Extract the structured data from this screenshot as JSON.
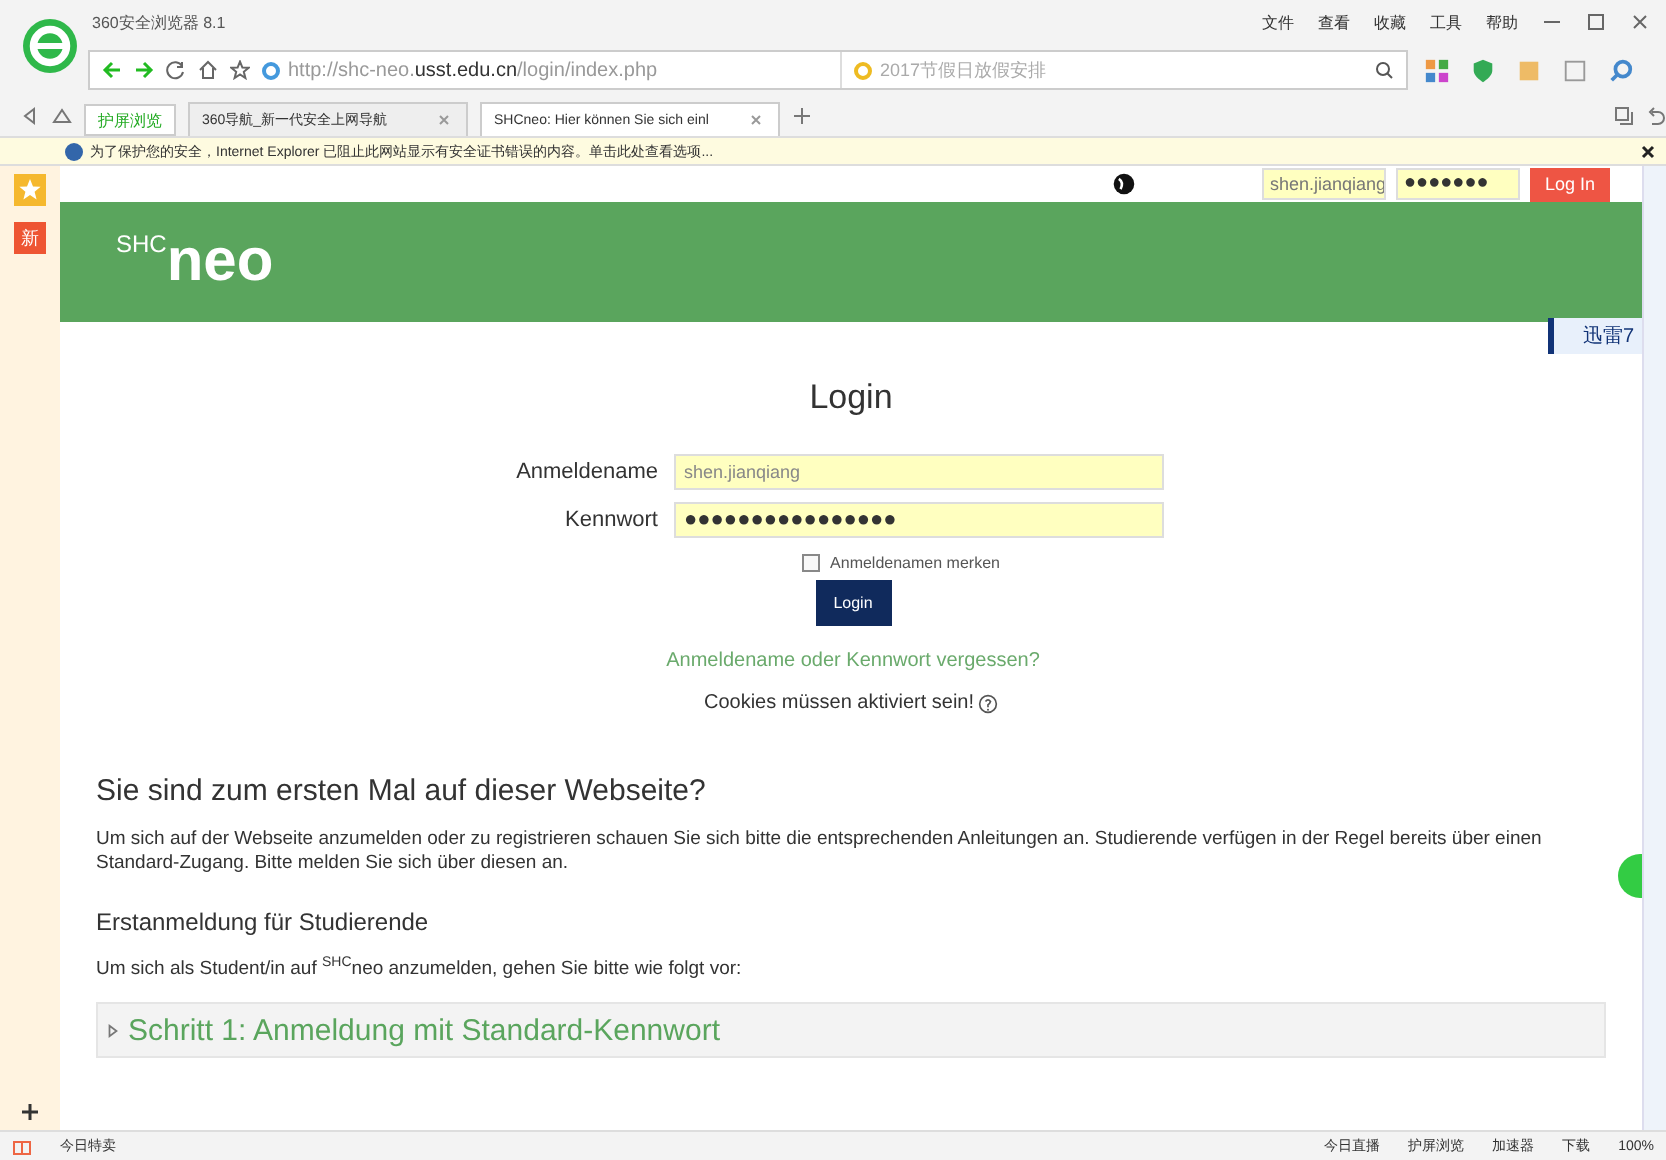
{
  "browser": {
    "title": "360安全浏览器 8.1",
    "menu": [
      "文件",
      "查看",
      "收藏",
      "工具",
      "帮助"
    ],
    "address": "http://shc-neo.**usst.edu.cn**/login/index.php",
    "search": {
      "placeholder": "2017节假日放假安排"
    },
    "screen_mode": "护屏浏览",
    "tabs": [
      {
        "label": "360导航_新一代安全上网导航",
        "selected": false
      },
      {
        "label": "SHCneo: Hier können Sie sich einl",
        "selected": true
      }
    ],
    "info_bar": "为了保护您的安全，Internet Explorer 已阻止此网站显示有安全证书错误的内容。单击此处查看选项...",
    "side_badge": "新",
    "download_badge": "迅雷7"
  },
  "page": {
    "top_login": {
      "username": "shen.jianqiang",
      "password": "●●●●●●●",
      "button": "Log In"
    },
    "logo": "$^{SHC}$neo",
    "login": {
      "title": "Login",
      "fields": [
        {
          "label": "Anmeldename",
          "value": "shen.jianqiang",
          "kind": "text"
        },
        {
          "label": "Kennwort",
          "value": "●●●●●●●●●●●●●●●●",
          "kind": "password"
        }
      ],
      "remember": {
        "label": "Anmeldenamen merken",
        "checked": false
      },
      "button": "Login",
      "forgot_link": "Anmeldename oder Kennwort vergessen?",
      "cookies_note": "Cookies müssen aktiviert sein!"
    },
    "heading": "Sie sind zum ersten Mal auf dieser Webseite?",
    "intro": "Um sich auf der Webseite anzumelden oder zu registrieren schauen Sie sich bitte die entsprechenden Anleitungen an. Studierende verfügen in der Regel bereits über einen Standard-Zugang. Bitte melden Sie sich über diesen an.",
    "subheading": "Erstanmeldung für Studierende",
    "sub_intro": "Um sich als Student/in auf $^{SHC}$neo anzumelden, gehen Sie bitte wie folgt vor:",
    "steps": [
      {
        "label": "Schritt 1: Anmeldung mit Standard-Kennwort",
        "expanded": false
      }
    ]
  },
  "status_bar": {
    "left": "今日特卖",
    "items": [
      "今日直播",
      "护屏浏览",
      "加速器",
      "下载"
    ],
    "zoom": "100%"
  }
}
